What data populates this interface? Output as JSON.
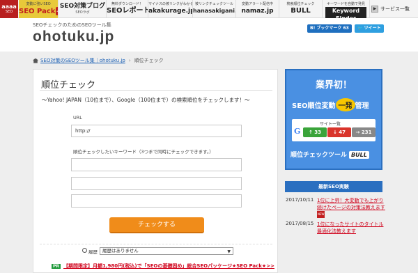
{
  "topbar": {
    "logo": {
      "line1": "aaaa",
      "line2": "SEO"
    },
    "items": [
      {
        "small": "変動に強いSEO",
        "big": "SEO Pack",
        "badge": "人気"
      },
      {
        "big": "SEO対策ブログ",
        "sub": "SEOラボ"
      },
      {
        "small": "無料ダウンロード！",
        "big": "SEOレポート"
      },
      {
        "small": "マイナスの被リンクがわかる",
        "big": "akakurage.jp"
      },
      {
        "small": "被リンクチェックツール",
        "big": "hanasakigani.jp"
      },
      {
        "small": "変動アラート配信中",
        "big": "namaz.jp"
      },
      {
        "small": "検索順位チェック",
        "big": "BULL"
      },
      {
        "small": "キーワードを自動で発見",
        "big": "Keyword Finder"
      }
    ],
    "service_link": "サービス一覧"
  },
  "header": {
    "tagline": "SEOチェックのためのSEOツール集",
    "logo": "ohotuku.jp",
    "hatebu": "B! ブックマーク 63",
    "tweet": "ツイート"
  },
  "breadcrumb": {
    "link": "SEO対策のSEOツール集｜ohotuku.jp",
    "separator": "›",
    "current": "順位チェック"
  },
  "main": {
    "title": "順位チェック",
    "description": "～Yahoo! JAPAN（10位まで）、Google（100位まで）の検索順位をチェックします！～",
    "url_label": "URL",
    "url_value": "http://",
    "keyword_label": "順位チェックしたいキーワード（3つまで同時にチェックできます。）",
    "submit": "チェックする",
    "history_label": "履歴",
    "history_select": "履歴はありません",
    "pr_badge": "PR",
    "pr_text": "【期間限定】月額1,980円(税込)で「SEOの基礎固め」総合SEOパッケージ★SEO Pack★>>"
  },
  "banner": {
    "top": "業界初！",
    "mid_before": "SEO順位変動",
    "mid_highlight": "一発",
    "mid_after": "管理",
    "box_label": "サイト一覧",
    "g_icon": "G",
    "up": "↑ 33",
    "down": "↓ 47",
    "same": "→ 231",
    "bottom": "順位チェックツール",
    "bull": "BULL"
  },
  "news": {
    "heading": "最新SEO実験",
    "items": [
      {
        "date": "2017/10/11",
        "title": "1位に上昇！大変動でも上がり続けたページの対策法教えます",
        "new": "NEW"
      },
      {
        "date": "2017/08/15",
        "title": "1位になったサイトのタイトル最適化法教えます",
        "new": ""
      }
    ]
  }
}
